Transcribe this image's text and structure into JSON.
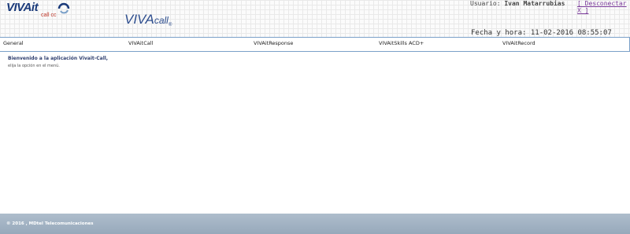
{
  "header": {
    "logo_text": "VIVAit",
    "logo_subtext": "call cc",
    "app_title": "VIVA",
    "app_title_suffix": "call",
    "app_title_mark": "®",
    "user_label": "Usuario:",
    "user_name": "Ivan Matarrubias",
    "logout_label": "[ Desconectar X ]",
    "datetime": "Fecha y hora: 11-02-2016 08:55:07"
  },
  "nav": {
    "items": [
      {
        "label": "General"
      },
      {
        "label": "VIVAitCall"
      },
      {
        "label": "VIVAitResponse"
      },
      {
        "label": "VIVAitSkills ACD+"
      },
      {
        "label": "VIVAitRecord"
      }
    ]
  },
  "main": {
    "welcome": "Bienvenido a la aplicación Vivait-Call,",
    "instruction": "elija la opción en el menú."
  },
  "footer": {
    "copyright": "© 2016 , MDtel Telecomunicaciones"
  },
  "colors": {
    "brand": "#1a3a7a",
    "accent": "#c0392b",
    "nav_border": "#7aa0c8",
    "footer_bg": "#a3b3c3",
    "link": "#7a3a9a"
  },
  "icons": [
    "logo-swirl-icon"
  ]
}
